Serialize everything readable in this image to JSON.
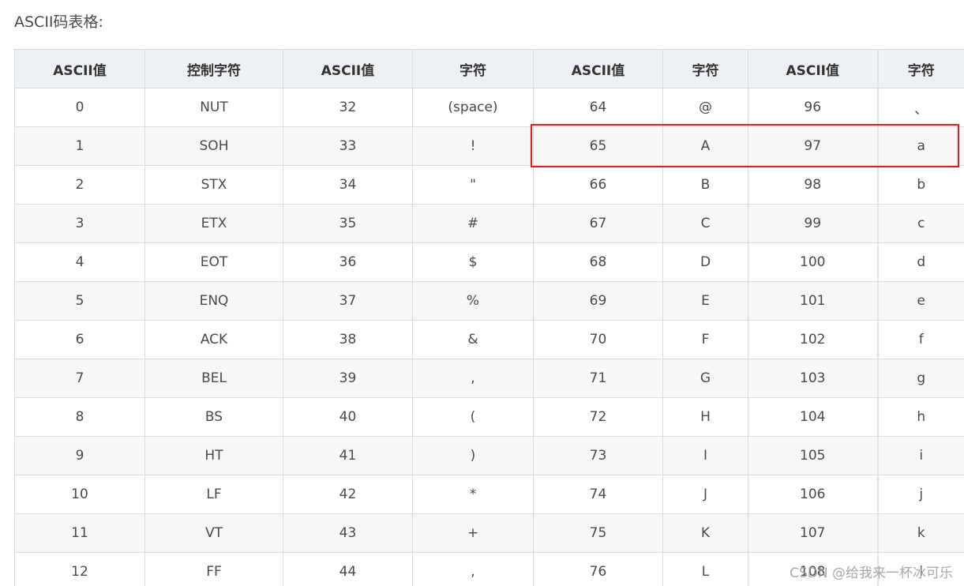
{
  "heading": "ASCII码表格:",
  "table": {
    "headers": [
      "ASCII值",
      "控制字符",
      "ASCII值",
      "字符",
      "ASCII值",
      "字符",
      "ASCII值",
      "字符"
    ],
    "rows": [
      [
        "0",
        "NUT",
        "32",
        "(space)",
        "64",
        "@",
        "96",
        "、"
      ],
      [
        "1",
        "SOH",
        "33",
        "!",
        "65",
        "A",
        "97",
        "a"
      ],
      [
        "2",
        "STX",
        "34",
        "\"",
        "66",
        "B",
        "98",
        "b"
      ],
      [
        "3",
        "ETX",
        "35",
        "#",
        "67",
        "C",
        "99",
        "c"
      ],
      [
        "4",
        "EOT",
        "36",
        "$",
        "68",
        "D",
        "100",
        "d"
      ],
      [
        "5",
        "ENQ",
        "37",
        "%",
        "69",
        "E",
        "101",
        "e"
      ],
      [
        "6",
        "ACK",
        "38",
        "&",
        "70",
        "F",
        "102",
        "f"
      ],
      [
        "7",
        "BEL",
        "39",
        ",",
        "71",
        "G",
        "103",
        "g"
      ],
      [
        "8",
        "BS",
        "40",
        "(",
        "72",
        "H",
        "104",
        "h"
      ],
      [
        "9",
        "HT",
        "41",
        ")",
        "73",
        "I",
        "105",
        "i"
      ],
      [
        "10",
        "LF",
        "42",
        "*",
        "74",
        "J",
        "106",
        "j"
      ],
      [
        "11",
        "VT",
        "43",
        "+",
        "75",
        "K",
        "107",
        "k"
      ],
      [
        "12",
        "FF",
        "44",
        ",",
        "76",
        "L",
        "108",
        "l"
      ]
    ]
  },
  "watermark": "CSDN @给我来一杯冰可乐",
  "colors": {
    "header_bg": "#eef1f4",
    "stripe_bg": "#f7f7f7",
    "highlight_border": "#e8191f"
  }
}
